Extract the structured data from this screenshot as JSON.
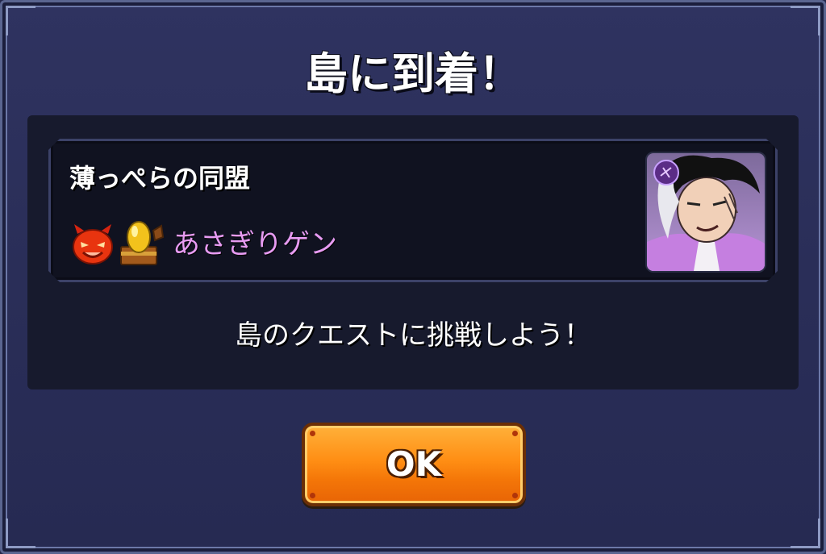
{
  "dialog": {
    "title": "島に到着！",
    "island": {
      "name": "薄っぺらの同盟",
      "character_name": "あさぎりゲン",
      "icons": [
        "devil-icon",
        "egg-chest-icon"
      ],
      "portrait": "character-portrait",
      "portrait_badge": "dark-element-icon"
    },
    "message": "島のクエストに挑戦しよう！",
    "ok_label": "OK"
  },
  "colors": {
    "character_name": "#e79bf2",
    "button": "#ff8e14",
    "background": "#2a2e58"
  }
}
